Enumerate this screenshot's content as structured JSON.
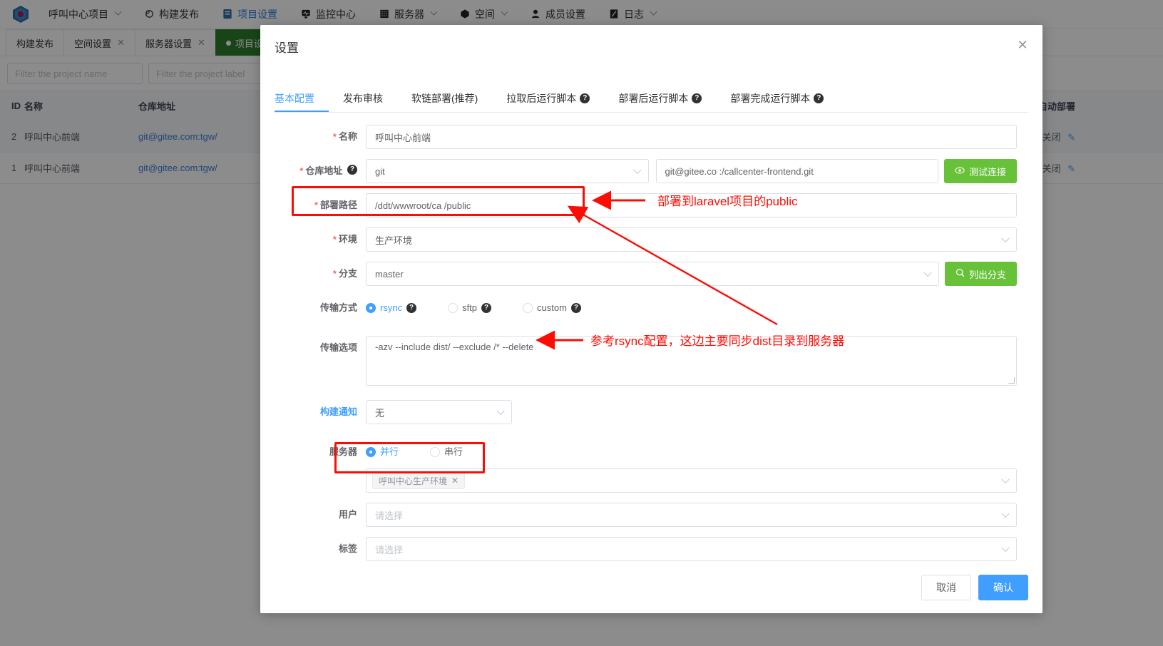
{
  "navbar": {
    "logo_icon": "hexagon-logo-icon",
    "items": [
      {
        "label": "呼叫中心项目",
        "icon": "none",
        "caret": true,
        "active": false
      },
      {
        "label": "构建发布",
        "icon": "rocket-icon",
        "caret": false,
        "active": false
      },
      {
        "label": "项目设置",
        "icon": "document-settings-icon",
        "caret": false,
        "active": true
      },
      {
        "label": "监控中心",
        "icon": "monitor-icon",
        "caret": false,
        "active": false
      },
      {
        "label": "服务器",
        "icon": "server-icon",
        "caret": true,
        "active": false
      },
      {
        "label": "空间",
        "icon": "cube-icon",
        "caret": true,
        "active": false
      },
      {
        "label": "成员设置",
        "icon": "user-icon",
        "caret": false,
        "active": false
      },
      {
        "label": "日志",
        "icon": "log-icon",
        "caret": true,
        "active": false
      }
    ]
  },
  "tabstrip": [
    {
      "label": "构建发布",
      "closable": false,
      "active": false
    },
    {
      "label": "空间设置",
      "closable": true,
      "active": false
    },
    {
      "label": "服务器设置",
      "closable": true,
      "active": false
    },
    {
      "label": "项目设置",
      "closable": true,
      "active": true
    }
  ],
  "filters": [
    {
      "placeholder": "Filter the project name",
      "value": ""
    },
    {
      "placeholder": "Filter the project label",
      "value": ""
    }
  ],
  "table": {
    "columns": [
      "ID",
      "名称",
      "仓库地址",
      "自动部署"
    ],
    "rows": [
      {
        "id": "2",
        "name": "呼叫中心前端",
        "repo": "git@gitee.com:tgw/",
        "auto": "关闭"
      },
      {
        "id": "1",
        "name": "呼叫中心前端",
        "repo": "git@gitee.com:tgw/",
        "auto": "关闭"
      }
    ]
  },
  "modal": {
    "title": "设置",
    "close_icon": "close-icon",
    "tabs": [
      {
        "label": "基本配置",
        "help": false,
        "active": true
      },
      {
        "label": "发布审核",
        "help": false,
        "active": false
      },
      {
        "label": "软链部署(推荐)",
        "help": false,
        "active": false
      },
      {
        "label": "拉取后运行脚本",
        "help": true,
        "active": false
      },
      {
        "label": "部署后运行脚本",
        "help": true,
        "active": false
      },
      {
        "label": "部署完成运行脚本",
        "help": true,
        "active": false
      }
    ],
    "form": {
      "name": {
        "label": "名称",
        "required": true,
        "value": "呼叫中心前端"
      },
      "repo": {
        "label": "仓库地址",
        "required": true,
        "help": true,
        "protocol": "git",
        "value": "git@gitee.co        :/callcenter-frontend.git",
        "test_button": "测试连接",
        "test_icon": "eye-icon"
      },
      "deploy_path": {
        "label": "部署路径",
        "required": true,
        "value": "/ddt/wwwroot/ca                        /public"
      },
      "environment": {
        "label": "环境",
        "required": true,
        "value": "生产环境"
      },
      "branch": {
        "label": "分支",
        "required": true,
        "value": "master",
        "list_button": "列出分支",
        "list_icon": "search-icon"
      },
      "transfer_mode": {
        "label": "传输方式",
        "options": [
          {
            "label": "rsync",
            "help": true,
            "selected": true
          },
          {
            "label": "sftp",
            "help": true,
            "selected": false
          },
          {
            "label": "custom",
            "help": true,
            "selected": false
          }
        ]
      },
      "transfer_options": {
        "label": "传输选项",
        "value": "-azv --include dist/ --exclude /* --delete"
      },
      "build_notify": {
        "label": "构建通知",
        "value": "无"
      },
      "server_mode": {
        "label": "服务器",
        "options": [
          {
            "label": "并行",
            "selected": true
          },
          {
            "label": "串行",
            "selected": false
          }
        ]
      },
      "servers": {
        "tags": [
          {
            "label": "呼叫中心生产环境",
            "close_icon": "tag-close-icon"
          }
        ]
      },
      "user": {
        "label": "用户",
        "placeholder": "请选择",
        "value": ""
      },
      "label_field": {
        "label": "标签",
        "placeholder": "请选择",
        "value": ""
      }
    },
    "footer": {
      "cancel": "取消",
      "confirm": "确认"
    }
  },
  "annotations": {
    "color": "#fb0d05",
    "notes": [
      {
        "text": "部署到laravel项目的public"
      },
      {
        "text": "参考rsync配置，这边主要同步dist目录到服务器"
      }
    ]
  }
}
